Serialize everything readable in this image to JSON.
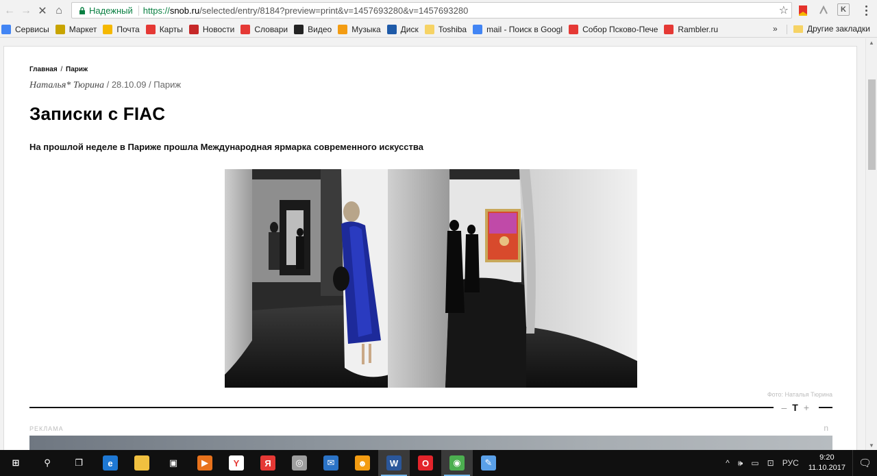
{
  "browser": {
    "secure_label": "Надежный",
    "url_scheme": "https://",
    "url_host": "snob.ru",
    "url_rest": "/selected/entry/8184?preview=print&v=1457693280&v=1457693280",
    "ext_k_label": "K",
    "bookmarks": [
      {
        "label": "Сервисы",
        "icon": "apps-grid-icon",
        "color": "#4285f4"
      },
      {
        "label": "Маркет",
        "icon": "market-icon",
        "color": "#c8a400"
      },
      {
        "label": "Почта",
        "icon": "mail-icon",
        "color": "#f5b800"
      },
      {
        "label": "Карты",
        "icon": "map-pin-icon",
        "color": "#e53935"
      },
      {
        "label": "Новости",
        "icon": "news-icon",
        "color": "#c62828"
      },
      {
        "label": "Словари",
        "icon": "dictionary-icon",
        "color": "#e53935"
      },
      {
        "label": "Видео",
        "icon": "video-icon",
        "color": "#222222"
      },
      {
        "label": "Музыка",
        "icon": "music-icon",
        "color": "#f39c12"
      },
      {
        "label": "Диск",
        "icon": "disk-icon",
        "color": "#1e5aa8"
      },
      {
        "label": "Toshiba",
        "icon": "folder-icon",
        "color": "#f6d365"
      },
      {
        "label": "mail - Поиск в Googl",
        "icon": "google-icon",
        "color": "#4285f4"
      },
      {
        "label": "Собор Псково-Пече",
        "icon": "yandex-icon",
        "color": "#e53935"
      },
      {
        "label": "Rambler.ru",
        "icon": "yandex-box-icon",
        "color": "#e53935"
      }
    ],
    "bookmarks_more": "»",
    "other_bookmarks": "Другие закладки"
  },
  "article": {
    "crumb_home": "Главная",
    "crumb_sep": "/",
    "crumb_section": "Париж",
    "author": "Наталья* Тюрина",
    "meta_rest": " / 28.10.09 / Париж",
    "title": "Записки с FIAC",
    "lead": "На прошлой неделе в Париже прошла Международная ярмарка современного искусства",
    "photo_credit": "Фото: Наталья Тюрина",
    "font_minus": "–",
    "font_T": "T",
    "font_plus": "+",
    "ad_label": "РЕКЛАМА",
    "ad_mark": "n"
  },
  "taskbar": {
    "apps": [
      {
        "name": "start",
        "icon": "windows-logo-icon",
        "color": "#101010",
        "glyph": "⊞"
      },
      {
        "name": "search",
        "icon": "search-icon",
        "color": "#101010",
        "glyph": "⚲"
      },
      {
        "name": "task-view",
        "icon": "task-view-icon",
        "color": "#101010",
        "glyph": "❐"
      },
      {
        "name": "edge",
        "icon": "edge-icon",
        "color": "#1e78d4",
        "glyph": "e"
      },
      {
        "name": "explorer",
        "icon": "folder-icon",
        "color": "#f0c040",
        "glyph": ""
      },
      {
        "name": "store",
        "icon": "store-icon",
        "color": "#101010",
        "glyph": "▣"
      },
      {
        "name": "media",
        "icon": "media-player-icon",
        "color": "#e8721c",
        "glyph": "▶"
      },
      {
        "name": "yandex-browser",
        "icon": "yandex-browser-icon",
        "color": "#ffffff",
        "glyph": "Y"
      },
      {
        "name": "yandex",
        "icon": "yandex-icon",
        "color": "#e53935",
        "glyph": "Я"
      },
      {
        "name": "app-circle",
        "icon": "circle-app-icon",
        "color": "#9e9e9e",
        "glyph": "◎"
      },
      {
        "name": "mail",
        "icon": "mail-icon",
        "color": "#2b73c6",
        "glyph": "✉"
      },
      {
        "name": "messenger",
        "icon": "messenger-icon",
        "color": "#f39c12",
        "glyph": "☻"
      },
      {
        "name": "word",
        "icon": "word-icon",
        "color": "#2b579a",
        "glyph": "W"
      },
      {
        "name": "opera",
        "icon": "opera-icon",
        "color": "#e3242b",
        "glyph": "O"
      },
      {
        "name": "chrome",
        "icon": "chrome-icon",
        "color": "#4caf50",
        "glyph": "◉"
      },
      {
        "name": "paint",
        "icon": "paint-icon",
        "color": "#5aa0e8",
        "glyph": "✎"
      }
    ],
    "active_apps": [
      "word",
      "chrome"
    ],
    "lang": "РУС",
    "time": "9:20",
    "date": "11.10.2017"
  }
}
